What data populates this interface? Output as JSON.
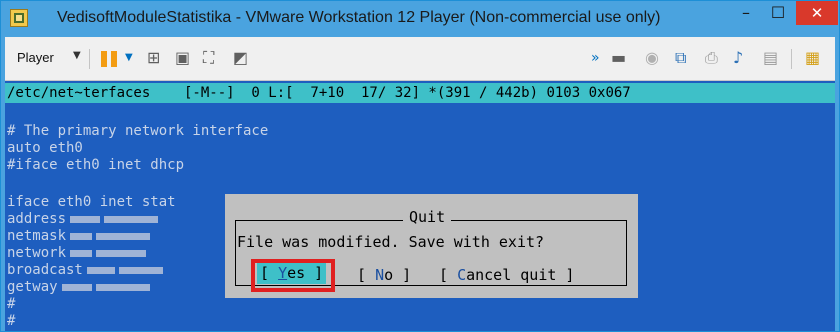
{
  "window": {
    "title": "VedisoftModuleStatistika - VMware Workstation 12 Player (Non-commercial use only)",
    "minimize_glyph": "–",
    "maximize_glyph": "☐",
    "close_glyph": "✕"
  },
  "toolbar": {
    "player_label": "Player",
    "icons": [
      "pause-icon",
      "send-ctrl-alt-del-icon",
      "removable-devices-icon",
      "fullscreen-icon",
      "unity-icon",
      "more-icon",
      "hard-disk-icon",
      "cd-dvd-icon",
      "network-adapter-icon",
      "printer-icon",
      "sound-card-icon",
      "message-log-icon",
      "snapshot-icon"
    ]
  },
  "editor": {
    "status_line": "/etc/net~terfaces    [-M--]  0 L:[  7+10  17/ 32] *(391 / 442b) 0103 0x067",
    "lines": [
      "# The primary network interface",
      "auto eth0",
      "#iface eth0 inet dhcp",
      "",
      "iface eth0 inet stat",
      "address",
      "netmask",
      "network",
      "broadcast",
      "getway",
      "#",
      "#"
    ]
  },
  "dialog": {
    "title": "Quit",
    "message": "File was modified. Save with exit?",
    "yes_open": "[ ",
    "yes_hotkey": "Y",
    "yes_rest": "es ]",
    "no_open": "[ ",
    "no_hotkey": "N",
    "no_rest": "o ]",
    "cancel_open": "[ ",
    "cancel_hotkey": "C",
    "cancel_rest": "ancel quit ]"
  },
  "colors": {
    "title_bar": "#4aa3df",
    "terminal_bg": "#1e5ebf",
    "status_bar": "#3ec0c8",
    "dialog_bg": "#c0c0c0",
    "highlight_box": "#e02020"
  }
}
